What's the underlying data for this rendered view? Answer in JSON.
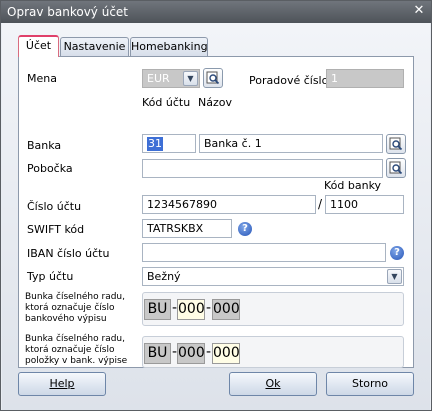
{
  "window": {
    "title": "Oprav bankový účet",
    "close": "✕"
  },
  "tabs": [
    {
      "label": "Účet",
      "active": true
    },
    {
      "label": "Nastavenie",
      "active": false
    },
    {
      "label": "Homebanking",
      "active": false
    }
  ],
  "form": {
    "mena_label": "Mena",
    "mena_value": "EUR",
    "poradove_label": "Poradové číslo",
    "poradove_value": "1",
    "kod_uctu_header": "Kód účtu",
    "nazov_header": "Názov",
    "banka_label": "Banka",
    "banka_code": "31",
    "banka_name": "Banka č. 1",
    "pobocka_label": "Pobočka",
    "pobocka_value": "",
    "kod_banky_header": "Kód banky",
    "cislo_uctu_label": "Číslo účtu",
    "cislo_uctu_value": "1234567890",
    "slash": "/",
    "kod_banky_value": "1100",
    "swift_label": "SWIFT kód",
    "swift_value": "TATRSKBX",
    "iban_label": "IBAN číslo účtu",
    "iban_value": "",
    "typ_label": "Typ účtu",
    "typ_value": "Bežný",
    "rad_vypisu_label": [
      "Bunka číselného radu,",
      "ktorá označuje číslo",
      "bankového výpisu"
    ],
    "rad_polozky_label": [
      "Bunka číselného radu,",
      "ktorá označuje číslo",
      "položky v bank. výpise"
    ],
    "mask1": {
      "prefix": "BU",
      "dash1": "-",
      "mid": "000",
      "dash2": "-",
      "end": "000"
    },
    "mask2": {
      "prefix": "BU",
      "dash1": "-",
      "mid": "000",
      "dash2": "-",
      "end": "000"
    }
  },
  "buttons": {
    "help": "Help",
    "ok": "Ok",
    "storno": "Storno"
  },
  "icons": {
    "lookup": "search-icon",
    "help": "question-icon",
    "dropdown": "chevron-down-icon"
  }
}
